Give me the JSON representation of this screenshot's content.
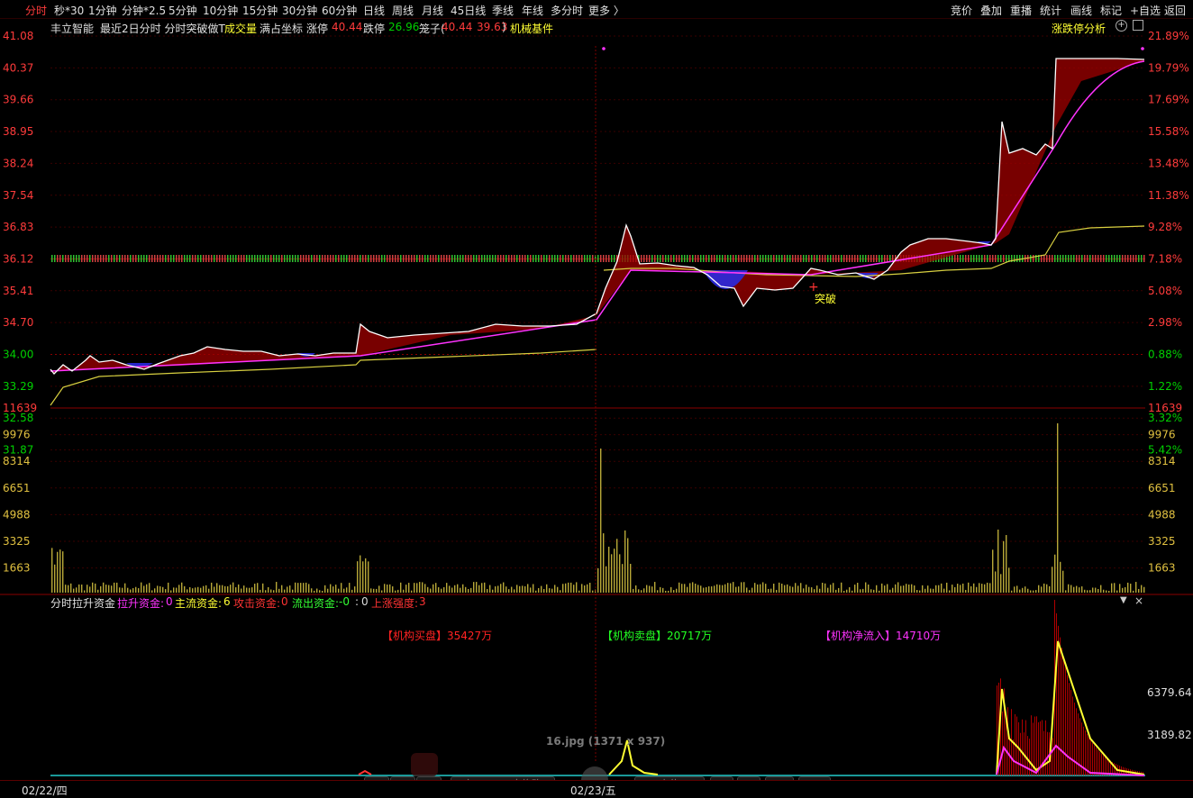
{
  "toolbar": {
    "periods": [
      "分时",
      "秒*30",
      "1分钟",
      "分钟*2.5",
      "5分钟",
      "10分钟",
      "15分钟",
      "30分钟",
      "60分钟",
      "日线",
      "周线",
      "月线",
      "45日线",
      "季线",
      "年线",
      "多分时",
      "更多 〉"
    ],
    "actions": [
      "竞价",
      "叠加",
      "重播",
      "统计",
      "画线",
      "标记",
      "+自选",
      "返回"
    ]
  },
  "info": {
    "stock": "丰立智能",
    "desc": "最近2日分时 分时突破做T",
    "volume_label": "成交量",
    "coord_label": "满占坐标",
    "limit_up_label": "涨停",
    "limit_up": "40.44",
    "limit_down_label": "跌停",
    "limit_down": "26.96",
    "bidask_label": "笼子(",
    "bidask_high": "40.44",
    "bidask_low": "39.63",
    "bidask_close": ")",
    "sector": "机械基件",
    "analysis": "涨跌停分析"
  },
  "price_axis": {
    "left": [
      "41.08",
      "40.37",
      "39.66",
      "38.95",
      "38.24",
      "37.54",
      "36.83",
      "36.12",
      "35.41",
      "34.70",
      "34.00",
      "33.29",
      "32.58",
      "31.87"
    ],
    "right": [
      "21.89%",
      "19.79%",
      "17.69%",
      "15.58%",
      "13.48%",
      "11.38%",
      "9.28%",
      "7.18%",
      "5.08%",
      "2.98%",
      "0.88%",
      "1.22%",
      "3.32%",
      "5.42%"
    ],
    "base_index": 10,
    "colors": {
      "up": "#ff3b3b",
      "down": "#00d000"
    }
  },
  "volume_axis": {
    "labels": [
      "11639",
      "9976",
      "8314",
      "6651",
      "4988",
      "3325",
      "1663"
    ]
  },
  "annotation": {
    "breakout": "突破"
  },
  "indicator": {
    "name": "分时拉升资金",
    "items": [
      {
        "label": "拉升资金:",
        "value": "0",
        "color": "#ff33ff"
      },
      {
        "label": "主流资金:",
        "value": "6",
        "color": "#ffff33"
      },
      {
        "label": "攻击资金:",
        "value": "0",
        "color": "#ff3333"
      },
      {
        "label": "流出资金:",
        "value": "-0",
        "color": "#33ff33"
      },
      {
        "label": ":",
        "value": "0",
        "color": "#dddddd"
      },
      {
        "label": "上涨强度:",
        "value": "3",
        "color": "#ff3333"
      }
    ],
    "labels": [
      {
        "text": "【机构买盘】35427万",
        "color": "#ff2222"
      },
      {
        "text": "【机构卖盘】20717万",
        "color": "#22ff22"
      },
      {
        "text": "【机构净流入】14710万",
        "color": "#ff33ff"
      }
    ],
    "axis": [
      "6379.64",
      "3189.82"
    ]
  },
  "dates": [
    "02/22/四",
    "02/23/五"
  ],
  "viewer": {
    "filename": "16.jpg (1371 x 937)",
    "buttons": [
      "+",
      "-",
      "1:1",
      "在 Picasa 中修改",
      "上传",
      "↺",
      "↻",
      "★",
      "▾"
    ]
  }
}
